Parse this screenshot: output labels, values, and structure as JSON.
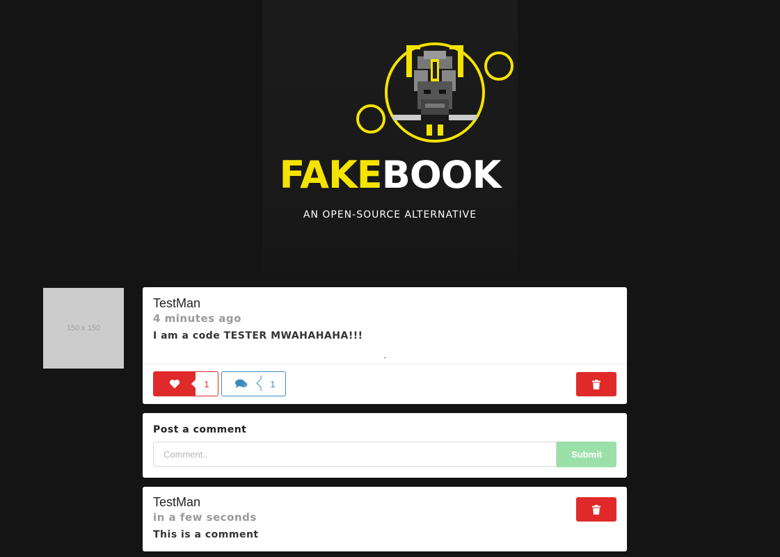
{
  "brand": {
    "part1": "FAKE",
    "part2": "BOOK",
    "tagline": "AN OPEN-SOURCE ALTERNATIVE"
  },
  "colors": {
    "brand_yellow": "#f4e300",
    "danger": "#e02a2a",
    "info": "#3b8dbd",
    "success_light": "#9be0a8",
    "background": "#141414"
  },
  "post": {
    "avatar_text": "150 x 150",
    "author": "TestMan",
    "timestamp": "4 minutes ago",
    "text": "I am a code TESTER MWAHAHAHA!!!",
    "likes": "1",
    "comments": "1",
    "icons": {
      "like": "heart-icon",
      "comment": "comments-icon",
      "delete": "trash-icon"
    }
  },
  "comment_form": {
    "label": "Post a comment",
    "placeholder": "Comment..",
    "value": "",
    "submit_label": "Submit"
  },
  "comments": [
    {
      "author": "TestMan",
      "timestamp": "in a few seconds",
      "text": "This is a comment"
    }
  ]
}
